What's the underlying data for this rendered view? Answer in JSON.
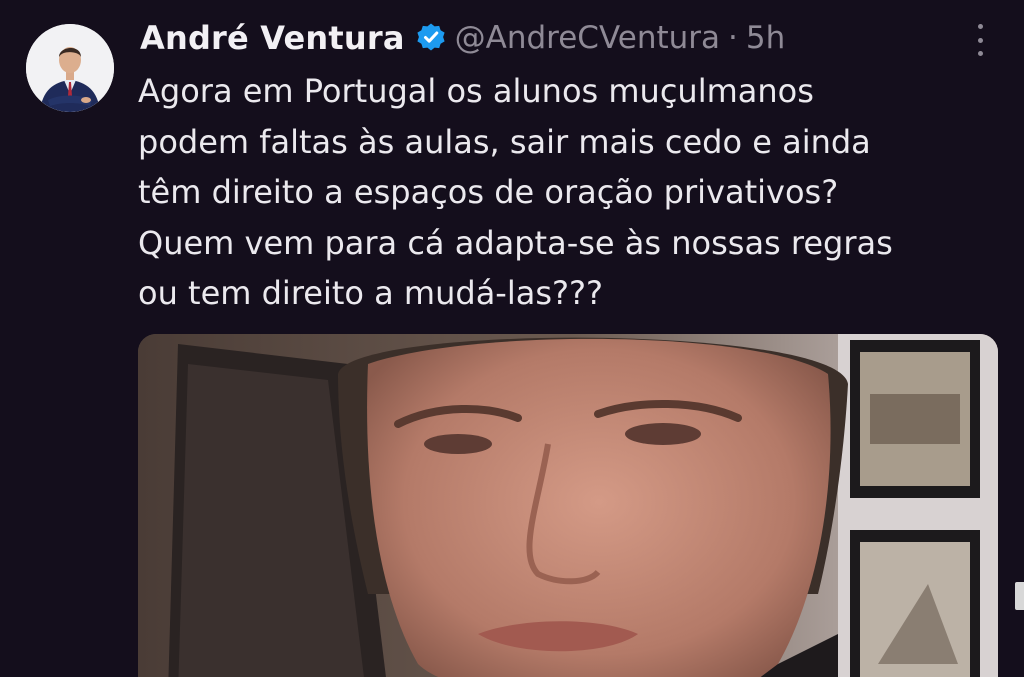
{
  "author": {
    "display_name": "André Ventura",
    "handle": "@AndreCVentura",
    "separator": "·",
    "timestamp": "5h"
  },
  "tweet": {
    "lines": [
      "Agora em Portugal os alunos muçulmanos",
      "podem faltas às aulas, sair mais cedo e ainda",
      "têm direito a espaços de oração privativos?",
      "Quem vem para cá adapta-se às nossas regras",
      "ou tem direito a mudá-las???"
    ]
  },
  "icons": {
    "verified": "verified-badge-icon",
    "more": "more-options-icon"
  },
  "colors": {
    "background": "#140e1c",
    "text": "#ebe9ee",
    "muted": "#8f8a96",
    "verified": "#1d9bf0"
  }
}
